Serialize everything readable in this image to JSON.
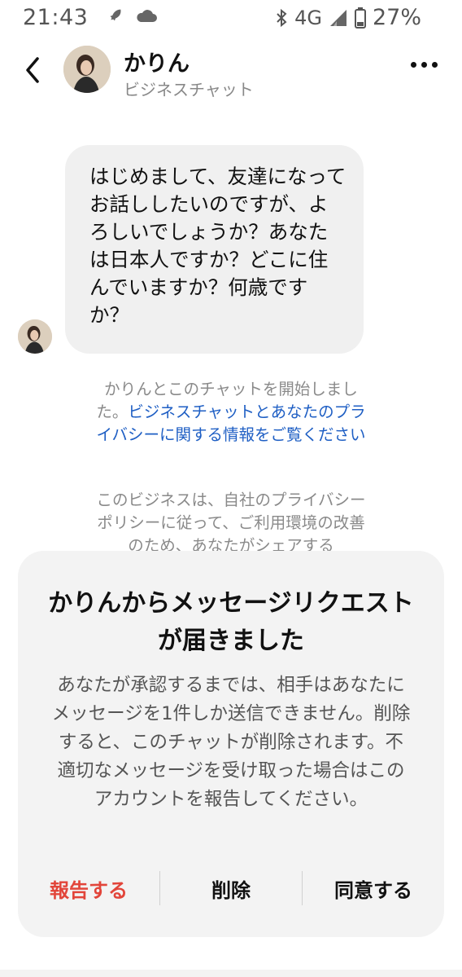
{
  "status_bar": {
    "time": "21:43",
    "network": "4G",
    "battery": "27%"
  },
  "header": {
    "name": "かりん",
    "subtitle": "ビジネスチャット"
  },
  "chat": {
    "message": "はじめまして、友達になってお話ししたいのですが、よろしいでしょうか？あなたは日本人ですか？どこに住んでいますか？何歳ですか？"
  },
  "info": {
    "started_text": "かりんとこのチャットを開始しました。",
    "privacy_link": "ビジネスチャットとあなたのプライバシーに関する情報をご覧ください",
    "policy_text": "このビジネスは、自社のプライバシーポリシーに従って、ご利用環境の改善のため、あなたがシェアする"
  },
  "request_sheet": {
    "title": "かりんからメッセージリクエストが届きました",
    "body": "あなたが承認するまでは、相手はあなたにメッセージを1件しか送信できません。削除すると、このチャットが削除されます。不適切なメッセージを受け取った場合はこのアカウントを報告してください。",
    "report_label": "報告する",
    "delete_label": "削除",
    "accept_label": "同意する"
  },
  "colors": {
    "link": "#1f5fc4",
    "report": "#e2453a",
    "bubble": "#f0f0f0",
    "sheet": "#f3f3f3"
  }
}
